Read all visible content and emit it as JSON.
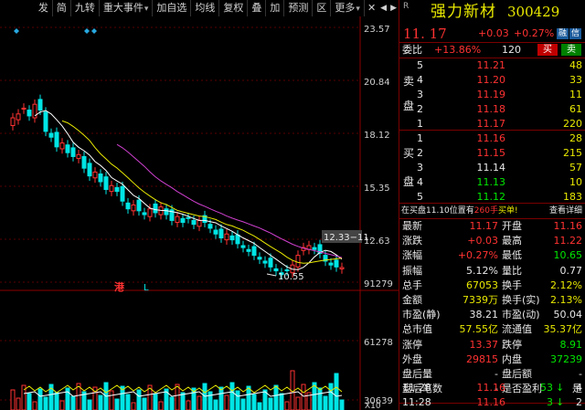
{
  "toolbar": {
    "items": [
      "发",
      "简",
      "九转",
      "重大事件",
      "加自选",
      "均线",
      "复权",
      "叠",
      "加",
      "预测",
      "区",
      "更多"
    ],
    "more_arrow": "▾",
    "close_glyph": "✕",
    "arrow_left": "◀",
    "arrow_right": "▶"
  },
  "chart": {
    "price_axis": [
      "23.57",
      "20.84",
      "18.12",
      "15.35",
      "12.63"
    ],
    "volume_axis": [
      "91279",
      "61278",
      "30639"
    ],
    "volume_unit": "X10",
    "high_label": "12.33",
    "high_label_suffix": "−11.",
    "low_label": "10.55",
    "marker_gang": "港",
    "marker_l": "L",
    "colors": {
      "up": "#ff3232",
      "down": "#00e5e5",
      "ma1": "#ffffff",
      "ma2": "#e8e800",
      "ma3": "#d040d0"
    }
  },
  "quote": {
    "r_mark": "R",
    "name": "强力新材",
    "code": "300429",
    "price": "11. 17",
    "change": "+0.03",
    "change_pct": "+0.27%",
    "badge_rz": "融",
    "badge_ct": "信",
    "weibi_label": "委比",
    "weibi_value": "+13.86%",
    "weicha_value": "120",
    "buy_btn": "买",
    "sell_btn": "卖",
    "sell_side_label": [
      "卖",
      "盘"
    ],
    "buy_side_label": [
      "买",
      "盘"
    ],
    "asks": [
      {
        "level": "5",
        "price": "11.21",
        "vol": "48"
      },
      {
        "level": "4",
        "price": "11.20",
        "vol": "33"
      },
      {
        "level": "3",
        "price": "11.19",
        "vol": "11"
      },
      {
        "level": "2",
        "price": "11.18",
        "vol": "61"
      },
      {
        "level": "1",
        "price": "11.17",
        "vol": "220"
      }
    ],
    "bids": [
      {
        "level": "1",
        "price": "11.16",
        "vol": "28"
      },
      {
        "level": "2",
        "price": "11.15",
        "vol": "215"
      },
      {
        "level": "3",
        "price": "11.14",
        "vol": "57"
      },
      {
        "level": "4",
        "price": "11.13",
        "vol": "10"
      },
      {
        "level": "5",
        "price": "11.12",
        "vol": "183"
      }
    ],
    "notice_prefix": "在买盘11.10位置有",
    "notice_vol": "260手",
    "notice_suffix": "买单!",
    "detail_link": "查看详细",
    "stats": [
      {
        "l1": "最新",
        "v1": "11.17",
        "c1": "red",
        "l2": "开盘",
        "v2": "11.16",
        "c2": "red"
      },
      {
        "l1": "涨跌",
        "v1": "+0.03",
        "c1": "red",
        "l2": "最高",
        "v2": "11.22",
        "c2": "red"
      },
      {
        "l1": "涨幅",
        "v1": "+0.27%",
        "c1": "red",
        "l2": "最低",
        "v2": "10.65",
        "c2": "green"
      },
      {
        "l1": "振幅",
        "v1": "5.12%",
        "c1": "white",
        "l2": "量比",
        "v2": "0.77",
        "c2": "white"
      },
      {
        "l1": "总手",
        "v1": "67053",
        "c1": "yellow",
        "l2": "换手",
        "v2": "2.12%",
        "c2": "yellow"
      },
      {
        "l1": "金额",
        "v1": "7339万",
        "c1": "yellow",
        "l2": "换手(实)",
        "v2": "2.13%",
        "c2": "yellow"
      },
      {
        "l1": "市盈(静)",
        "v1": "38.21",
        "c1": "white",
        "l2": "市盈(动)",
        "v2": "50.04",
        "c2": "white"
      },
      {
        "l1": "总市值",
        "v1": "57.55亿",
        "c1": "yellow",
        "l2": "流通值",
        "v2": "35.37亿",
        "c2": "yellow"
      },
      {
        "l1": "涨停",
        "v1": "13.37",
        "c1": "red",
        "l2": "跌停",
        "v2": "8.91",
        "c2": "green"
      },
      {
        "l1": "外盘",
        "v1": "29815",
        "c1": "red",
        "l2": "内盘",
        "v2": "37239",
        "c2": "green"
      },
      {
        "l1": "盘后量",
        "v1": "-",
        "c1": "white",
        "l2": "盘后额",
        "v2": "-",
        "c2": "white"
      },
      {
        "l1": "盘后笔数",
        "v1": "-",
        "c1": "white",
        "l2": "是否盈利",
        "v2": "是",
        "c2": "white"
      }
    ],
    "ticks": [
      {
        "time": "11:28",
        "price": "11.16",
        "vol": "53",
        "dir": "↓",
        "cnt": "4"
      },
      {
        "time": "11:28",
        "price": "11.16",
        "vol": "3",
        "dir": "↓",
        "cnt": "2"
      }
    ]
  }
}
